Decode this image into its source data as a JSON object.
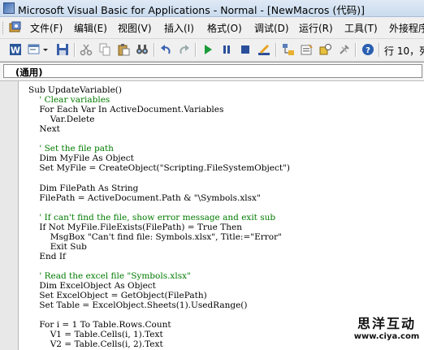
{
  "window": {
    "title": "Microsoft Visual Basic for Applications - Normal - [NewMacros (代码)]"
  },
  "menu": {
    "items": [
      "文件(F)",
      "编辑(E)",
      "视图(V)",
      "插入(I)",
      "格式(O)",
      "调试(D)",
      "运行(R)",
      "工具(T)",
      "外接程序"
    ]
  },
  "toolbar": {
    "row_col": "行 10，列"
  },
  "code_window": {
    "object_box": "(通用)",
    "lines": [
      {
        "t": "Sub UpdateVariable()",
        "c": false
      },
      {
        "t": "    ' Clear variables",
        "c": true
      },
      {
        "t": "    For Each Var In ActiveDocument.Variables",
        "c": false
      },
      {
        "t": "        Var.Delete",
        "c": false
      },
      {
        "t": "    Next",
        "c": false
      },
      {
        "t": "",
        "c": false
      },
      {
        "t": "    ' Set the file path",
        "c": true
      },
      {
        "t": "    Dim MyFile As Object",
        "c": false
      },
      {
        "t": "    Set MyFile = CreateObject(\"Scripting.FileSystemObject\")",
        "c": false
      },
      {
        "t": "",
        "c": false
      },
      {
        "t": "    Dim FilePath As String",
        "c": false
      },
      {
        "t": "    FilePath = ActiveDocument.Path & \"\\Symbols.xlsx\"",
        "c": false
      },
      {
        "t": "",
        "c": false
      },
      {
        "t": "    ' If can't find the file, show error message and exit sub",
        "c": true
      },
      {
        "t": "    If Not MyFile.FileExists(FilePath) = True Then",
        "c": false
      },
      {
        "t": "        MsgBox \"Can't find file: Symbols.xlsx\", Title:=\"Error\"",
        "c": false
      },
      {
        "t": "        Exit Sub",
        "c": false
      },
      {
        "t": "    End If",
        "c": false
      },
      {
        "t": "",
        "c": false
      },
      {
        "t": "    ' Read the excel file \"Symbols.xlsx\"",
        "c": true
      },
      {
        "t": "    Dim ExcelObject As Object",
        "c": false
      },
      {
        "t": "    Set ExcelObject = GetObject(FilePath)",
        "c": false
      },
      {
        "t": "    Set Table = ExcelObject.Sheets(1).UsedRange()",
        "c": false
      },
      {
        "t": "",
        "c": false
      },
      {
        "t": "    For i = 1 To Table.Rows.Count",
        "c": false
      },
      {
        "t": "        V1 = Table.Cells(i, 1).Text",
        "c": false
      },
      {
        "t": "        V2 = Table.Cells(i, 2).Text",
        "c": false
      }
    ]
  },
  "watermark": {
    "line1": "思洋互动",
    "line2": "www.ciya.com"
  }
}
